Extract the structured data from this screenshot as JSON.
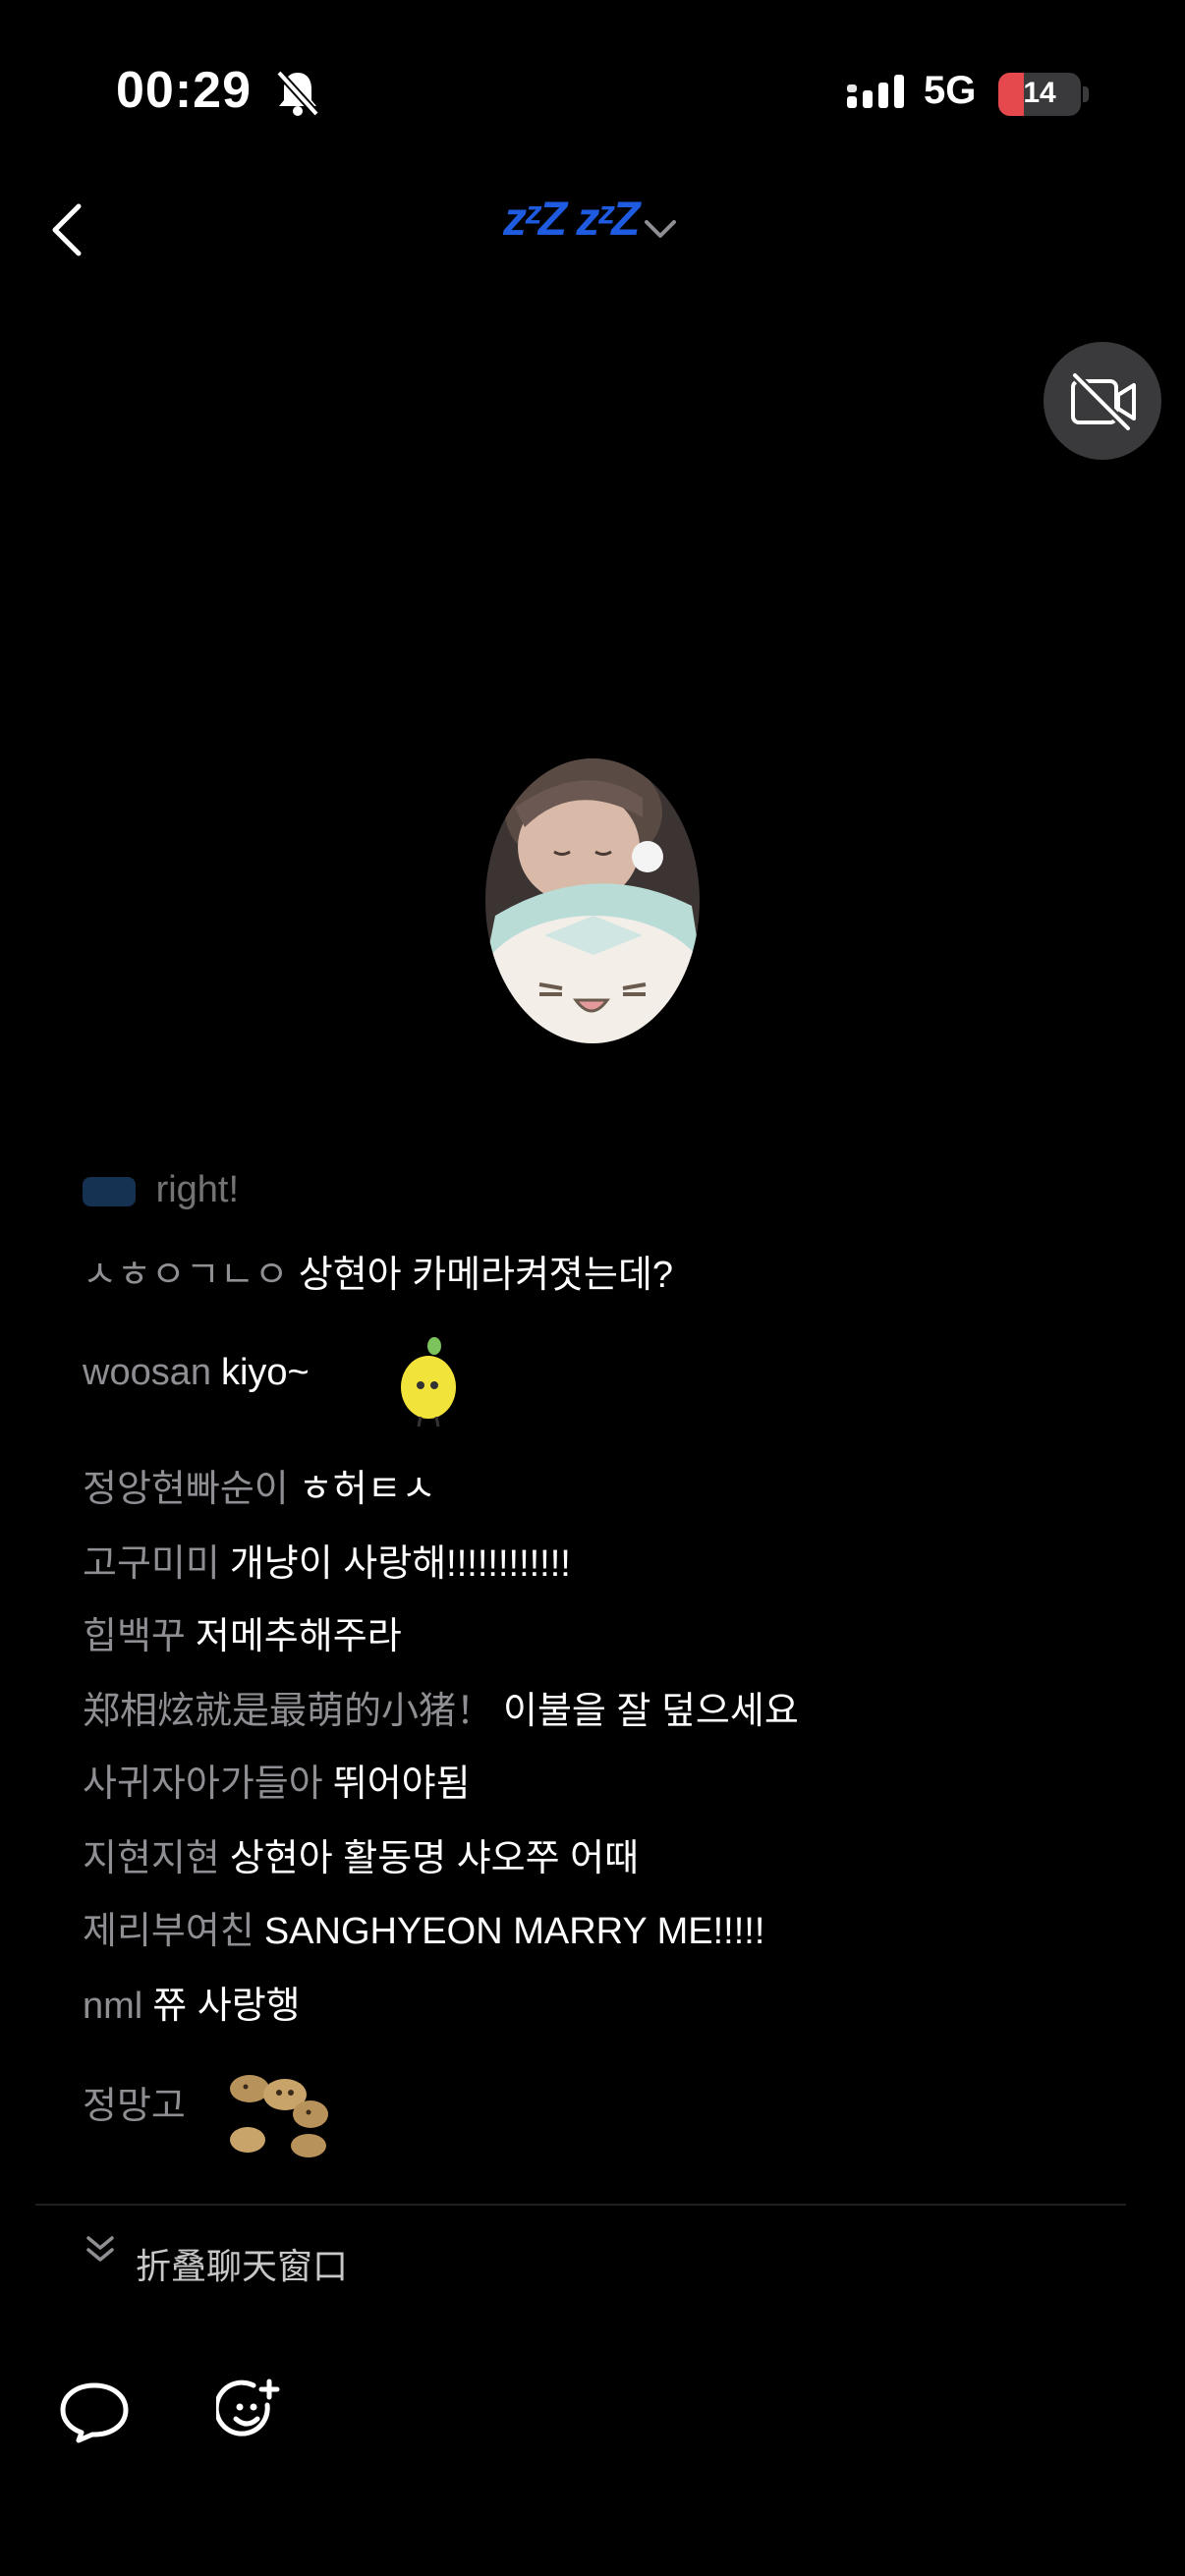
{
  "status_bar": {
    "time": "00:29",
    "network": "5G",
    "battery_level": "14",
    "battery_fraction": 0.14
  },
  "header": {
    "title": "zᶻZ zᶻZ"
  },
  "chat": {
    "partial_message": {
      "user": "",
      "text": "right!"
    },
    "messages": [
      {
        "user": "ㅅㅎㅇㄱㄴㅇ",
        "text": "상현아 카메라켜졋는데?"
      },
      {
        "user": "woosan",
        "text": "kiyo~",
        "sticker": "lemon-sticker"
      },
      {
        "user": "정앙현빠순이",
        "text": "ㅎ허ㅌㅅ"
      },
      {
        "user": "고구미미",
        "text": "개냥이 사랑해!!!!!!!!!!!!"
      },
      {
        "user": "힙백꾸",
        "text": "저메추해주라"
      },
      {
        "user": "郑相炫就是最萌的小猪！",
        "text": "이불을 잘 덮으세요"
      },
      {
        "user": "사귀자아가들아",
        "text": "뛰어야됨"
      },
      {
        "user": "지현지현",
        "text": "상현아 활동명 샤오쭈 어때"
      },
      {
        "user": "제리부여친",
        "text": "SANGHYEON MARRY ME!!!!!"
      },
      {
        "user": "nml",
        "text": "쮸 사랑행"
      },
      {
        "user": "정망고",
        "text": "",
        "sticker": "cookies-sticker"
      }
    ]
  },
  "footer": {
    "collapse_label": "折叠聊天窗口"
  },
  "colors": {
    "background": "#000000",
    "title_blue": "#1e5be0",
    "username_gray": "#8e8e93",
    "battery_red": "#e5484d"
  }
}
